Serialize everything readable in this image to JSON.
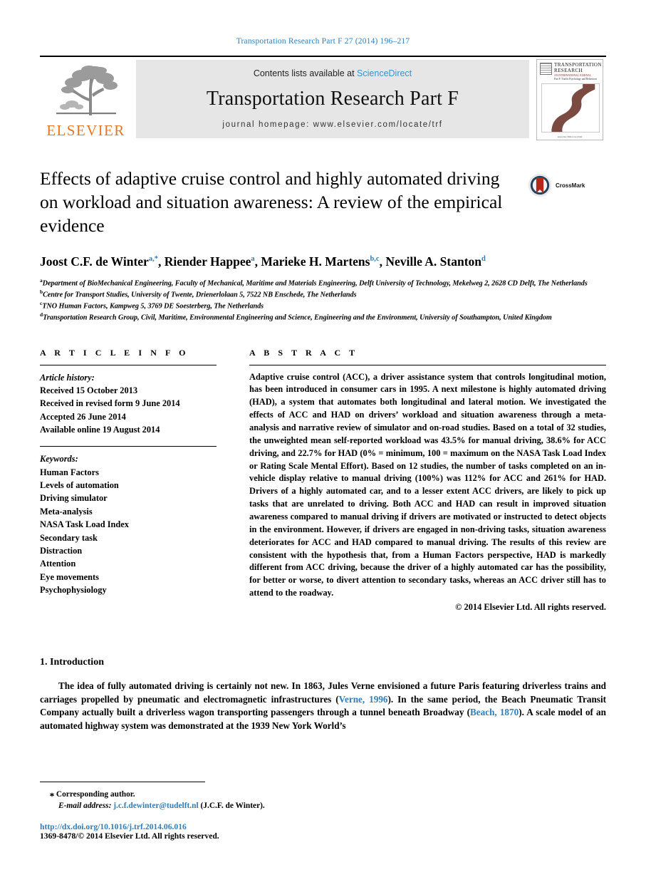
{
  "running_head": "Transportation Research Part F 27 (2014) 196–217",
  "masthead": {
    "publisher_name": "ELSEVIER",
    "contents_prefix": "Contents lists available at",
    "contents_link": "ScienceDirect",
    "journal_title": "Transportation Research Part F",
    "homepage": "journal homepage: www.elsevier.com/locate/trf",
    "cover": {
      "line1": "TRANSPORTATION",
      "line2": "RESEARCH",
      "line3": "AN INTERNATIONAL JOURNAL",
      "line4": "Part F: Traffic Psychology and Behaviour",
      "footer": "Associate Editor-in-Chief\nFrank P. McKenna"
    }
  },
  "article": {
    "title": "Effects of adaptive cruise control and highly automated driving on workload and situation awareness: A review of the empirical evidence",
    "crossmark_label": "CrossMark",
    "authors": [
      {
        "name": "Joost C.F. de Winter",
        "sup": "a,*"
      },
      {
        "name": "Riender Happee",
        "sup": "a"
      },
      {
        "name": "Marieke H. Martens",
        "sup": "b,c"
      },
      {
        "name": "Neville A. Stanton",
        "sup": "d"
      }
    ],
    "affiliations": [
      {
        "mark": "a",
        "text": "Department of BioMechanical Engineering, Faculty of Mechanical, Maritime and Materials Engineering, Delft University of Technology, Mekelweg 2, 2628 CD Delft, The Netherlands"
      },
      {
        "mark": "b",
        "text": "Centre for Transport Studies, University of Twente, Drienerlolaan 5, 7522 NB Enschede, The Netherlands"
      },
      {
        "mark": "c",
        "text": "TNO Human Factors, Kampweg 5, 3769 DE Soesterberg, The Netherlands"
      },
      {
        "mark": "d",
        "text": "Transportation Research Group, Civil, Maritime, Environmental Engineering and Science, Engineering and the Environment, University of Southampton, United Kingdom"
      }
    ]
  },
  "article_info": {
    "heading": "A R T I C L E    I N F O",
    "history_label": "Article history:",
    "history": [
      "Received 15 October 2013",
      "Received in revised form 9 June 2014",
      "Accepted 26 June 2014",
      "Available online 19 August 2014"
    ],
    "keywords_label": "Keywords:",
    "keywords": [
      "Human Factors",
      "Levels of automation",
      "Driving simulator",
      "Meta-analysis",
      "NASA Task Load Index",
      "Secondary task",
      "Distraction",
      "Attention",
      "Eye movements",
      "Psychophysiology"
    ]
  },
  "abstract": {
    "heading": "A B S T R A C T",
    "text": "Adaptive cruise control (ACC), a driver assistance system that controls longitudinal motion, has been introduced in consumer cars in 1995. A next milestone is highly automated driving (HAD), a system that automates both longitudinal and lateral motion. We investigated the effects of ACC and HAD on drivers’ workload and situation awareness through a meta-analysis and narrative review of simulator and on-road studies. Based on a total of 32 studies, the unweighted mean self-reported workload was 43.5% for manual driving, 38.6% for ACC driving, and 22.7% for HAD (0% = minimum, 100 = maximum on the NASA Task Load Index or Rating Scale Mental Effort). Based on 12 studies, the number of tasks completed on an in-vehicle display relative to manual driving (100%) was 112% for ACC and 261% for HAD. Drivers of a highly automated car, and to a lesser extent ACC drivers, are likely to pick up tasks that are unrelated to driving. Both ACC and HAD can result in improved situation awareness compared to manual driving if drivers are motivated or instructed to detect objects in the environment. However, if drivers are engaged in non-driving tasks, situation awareness deteriorates for ACC and HAD compared to manual driving. The results of this review are consistent with the hypothesis that, from a Human Factors perspective, HAD is markedly different from ACC driving, because the driver of a highly automated car has the possibility, for better or worse, to divert attention to secondary tasks, whereas an ACC driver still has to attend to the roadway.",
    "copyright": "© 2014 Elsevier Ltd. All rights reserved."
  },
  "introduction": {
    "heading": "1. Introduction",
    "paragraph_part1": "The idea of fully automated driving is certainly not new. In 1863, Jules Verne envisioned a future Paris featuring driverless trains and carriages propelled by pneumatic and electromagnetic infrastructures (",
    "cite1": "Verne, 1996",
    "paragraph_part2": "). In the same period, the Beach Pneumatic Transit Company actually built a driverless wagon transporting passengers through a tunnel beneath Broadway (",
    "cite2": "Beach, 1870",
    "paragraph_part3": "). A scale model of an automated highway system was demonstrated at the 1939 New York World’s"
  },
  "footer": {
    "corresponding_star": "⁎",
    "corresponding_label": "Corresponding author.",
    "email_label": "E-mail address:",
    "email": "j.c.f.dewinter@tudelft.nl",
    "email_suffix": "(J.C.F. de Winter).",
    "doi": "http://dx.doi.org/10.1016/j.trf.2014.06.016",
    "issn_line": "1369-8478/© 2014 Elsevier Ltd. All rights reserved."
  },
  "colors": {
    "link": "#2E7EBB",
    "sciencedirect": "#3C92CA",
    "elsevier_orange": "#E87722",
    "band_gray": "#e6e6e6",
    "crossmark_blue": "#20415F",
    "crossmark_red": "#B5261E",
    "cover_road": "#7B4A41"
  }
}
